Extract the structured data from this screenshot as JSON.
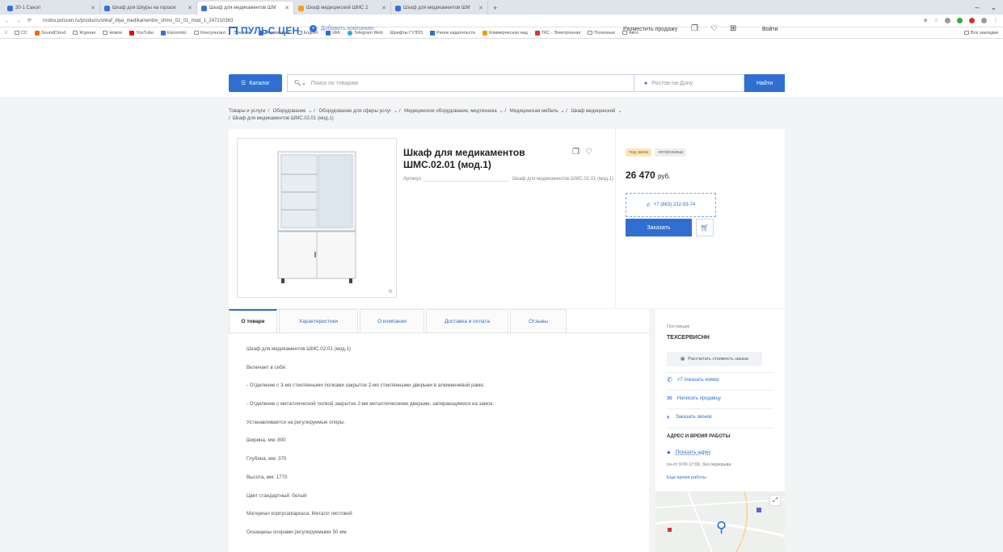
{
  "browser": {
    "tabs": [
      {
        "label": "30-1 Санэп"
      },
      {
        "label": "Шкаф для Шкуры на горшок"
      },
      {
        "label": "Шкаф для медикаментов ШМ"
      },
      {
        "label": "Шкаф медицинский ШМС 2"
      },
      {
        "label": "Шкаф для медикаментов ШМ"
      }
    ],
    "url": "rostov.pulscen.ru/products/shkaf_dlya_medikamentov_shms_02_01_mod_1_247210363",
    "bookmarks": [
      "CC",
      "SoundCloud",
      "Журнал",
      "Новое",
      "YouTube",
      "Ekonomic",
      "Консультант",
      "Элемент",
      "Переводчик",
      "English",
      "VAK",
      "Telegram Web",
      "Шрифты ГУЭЗЗ",
      "Ринок издательств",
      "Коммерческая нед",
      "ТКС - Электронная",
      "Полезные",
      "Авто"
    ],
    "bookmarks_other": "Все закладки"
  },
  "header": {
    "logo": "ПУЛЬС ЦЕН",
    "add_company": "Добавить компанию",
    "place_ad": "Разместить продажу",
    "login": "Войти",
    "catalog": "Каталог",
    "search_placeholder": "Поиск по товарам",
    "city_placeholder": "Ростов-на-Дону",
    "find": "Найти"
  },
  "breadcrumbs": [
    "Товары и услуги",
    "Оборудование",
    "Оборудование для сферы услуг",
    "Медицинское оборудование, медтехника",
    "Медицинская мебель",
    "Шкаф медицинский",
    "Шкаф для медикаментов ШМС.02.01 (мод.1)"
  ],
  "product": {
    "title": "Шкаф для медикаментов ШМС.02.01 (мод.1)",
    "article_label": "Артикул",
    "article_value": "Шкаф для медикаментов ШМС.02.01 (мод.1)",
    "badge_pre": "под заказ",
    "badge_opt": "опт/розница",
    "price": "26 470",
    "currency": "руб.",
    "phone": "+7 (863) 232-93-74",
    "order": "Заказать"
  },
  "tabs": [
    "О товаре",
    "Характеристики",
    "О компании",
    "Доставка и оплата",
    "Отзывы"
  ],
  "description": [
    "Шкаф для медикаментов ШМС.02.01 (мод.1)",
    "Включает в себя:",
    "- Отделение с 3-мя стеклянными полками закрытое 2-мя стеклянными дверьми в алюминиевой раме;",
    "- Отделение с металлической полкой закрытое 2-мя металлическими дверьми, запирающимися на замок.",
    "Устанавливается на регулируемые опоры.",
    "Ширина, мм: 800",
    "Глубина, мм: 370",
    "Высота, мм: 1770",
    "Цвет стандартный: белый",
    "Материал корпуса/каркаса: Металл листовой",
    "Оснащены опорами регулируемыми 50 мм"
  ],
  "seller": {
    "label": "Поставщик",
    "name": "ТЕХСЕРВИСНН",
    "calc": "Рассчитать стоимость заказа",
    "phone": "+7 показать номер",
    "write": "Написать продавцу",
    "callback": "Заказать звонок",
    "address_header": "АДРЕС И ВРЕМЯ РАБОТЫ",
    "show_address": "Показать адрес",
    "hours": "пн-пт 9:00-17:00, без перерыва",
    "more_hours": "Еще время работы"
  },
  "colors": {
    "accent": "#2f6fd1",
    "badge": "#fbe6b8"
  }
}
